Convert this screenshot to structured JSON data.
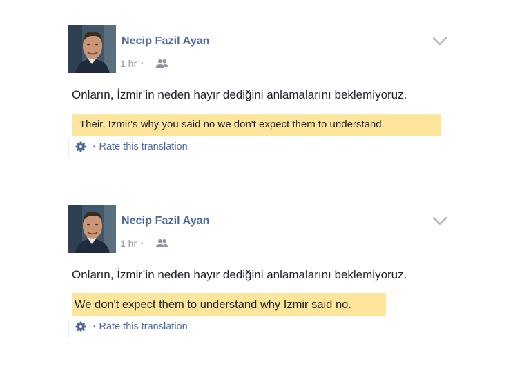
{
  "colors": {
    "name": "#4b67a1",
    "meta": "#9197a3",
    "highlight": "#fde69b",
    "text": "#1d2129"
  },
  "posts": [
    {
      "author": "Necip Fazil Ayan",
      "time": "1 hr",
      "separator": "•",
      "audience_icon": "friends-icon",
      "menu_icon": "chevron-down-icon",
      "original_text": "Onların, İzmir’in neden hayır dediğini anlamalarını beklemiyoruz.",
      "translation": "Their, Izmir's why you said no we don't expect them to understand.",
      "settings_icon": "gear-icon",
      "rate_separator": "•",
      "rate_label": "Rate this translation"
    },
    {
      "author": "Necip Fazil Ayan",
      "time": "1 hr",
      "separator": "•",
      "audience_icon": "friends-icon",
      "menu_icon": "chevron-down-icon",
      "original_text": "Onların, İzmir’in neden hayır dediğini anlamalarını beklemiyoruz.",
      "translation": "We don't expect them to understand why Izmir said no.",
      "settings_icon": "gear-icon",
      "rate_separator": "•",
      "rate_label": "Rate this translation"
    }
  ]
}
